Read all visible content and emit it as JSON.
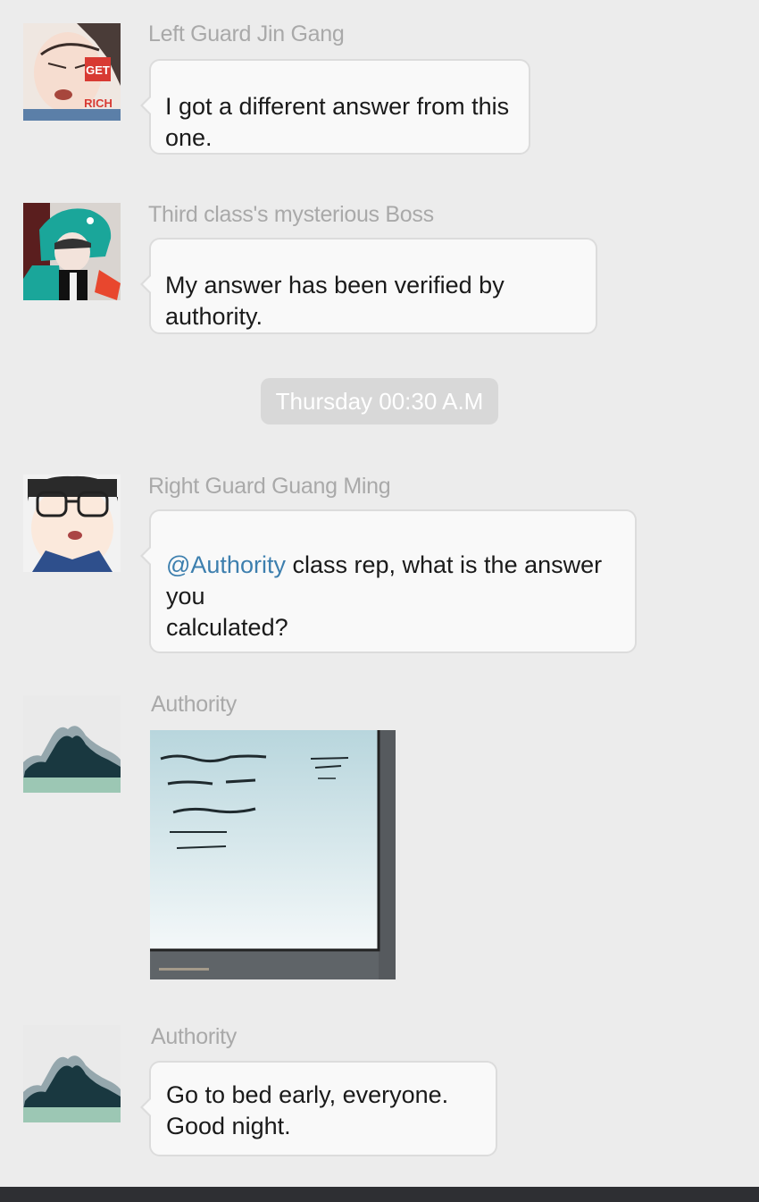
{
  "messages": [
    {
      "sender": "Left Guard Jin Gang",
      "text": "I got a different answer from this one.",
      "avatar_badge_top": "GET",
      "avatar_badge_bottom": "RICH"
    },
    {
      "sender": "Third class's mysterious Boss",
      "text": "My answer has been verified by authority."
    },
    {
      "sender": "Right Guard Guang Ming",
      "mention": "@Authority",
      "text_line1": " class rep, what is the answer you",
      "text_line2": "calculated?"
    },
    {
      "sender": "Authority",
      "attachment": "image"
    },
    {
      "sender": "Authority",
      "text_line1": "Go to bed early, everyone.",
      "text_line2": "Good night."
    }
  ],
  "timestamp": "Thursday 00:30 A.M",
  "colors": {
    "background": "#ececec",
    "bubble": "#f9f9f9",
    "bubble_border": "#dcdcdc",
    "sender_name": "#a9a9a9",
    "mention": "#3d7fae",
    "timestamp_pill": "#d8d8d8",
    "bottom_bar": "#2e2f33"
  },
  "icons": [
    "avatar-man-get-rich",
    "avatar-boy-dino-hood",
    "avatar-boy-glasses",
    "avatar-mountain",
    "avatar-mountain"
  ]
}
